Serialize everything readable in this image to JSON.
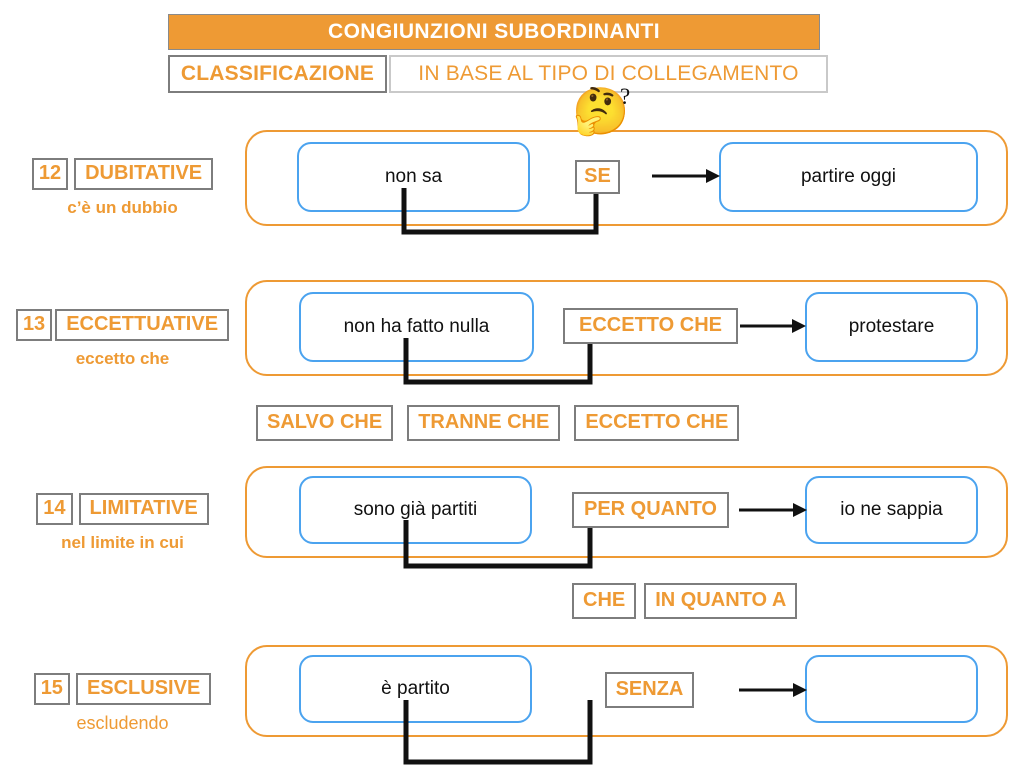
{
  "header": {
    "title": "CONGIUNZIONI SUBORDINANTI",
    "classification_label": "CLASSIFICAZIONE",
    "classification_value": "IN BASE AL TIPO DI COLLEGAMENTO"
  },
  "colors": {
    "orange": "#ee9a34",
    "blue": "#4ba3ef",
    "grey_border": "#7d7d7d",
    "light_grey_border": "#c9c9c9",
    "black": "#111111",
    "white": "#ffffff"
  },
  "emoji": {
    "thinking_face": "🤔",
    "question_mark": "?"
  },
  "rows": [
    {
      "number": "12",
      "category": "DUBITATIVE",
      "subtitle": "c’è un dubbio",
      "main_clause": "non sa",
      "conjunction": "SE",
      "subordinate_clause": "partire oggi",
      "alternatives": []
    },
    {
      "number": "13",
      "category": "ECCETTUATIVE",
      "subtitle": "eccetto che",
      "main_clause": "non ha fatto nulla",
      "conjunction": "ECCETTO CHE",
      "subordinate_clause": "protestare",
      "alternatives": [
        "SALVO CHE",
        "TRANNE CHE",
        "ECCETTO CHE"
      ]
    },
    {
      "number": "14",
      "category": "LIMITATIVE",
      "subtitle": "nel limite in cui",
      "main_clause": "sono già partiti",
      "conjunction": "PER QUANTO",
      "subordinate_clause": "io ne sappia",
      "alternatives": [
        "CHE",
        "IN QUANTO A"
      ]
    },
    {
      "number": "15",
      "category": "ESCLUSIVE",
      "subtitle": "escludendo",
      "main_clause": "è partito",
      "conjunction": "SENZA",
      "subordinate_clause": "",
      "alternatives": []
    }
  ]
}
